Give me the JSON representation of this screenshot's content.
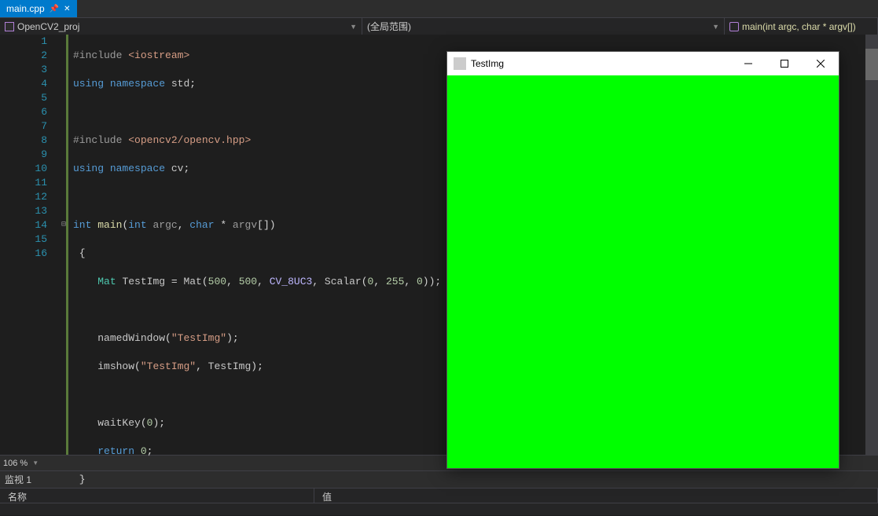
{
  "tab": {
    "label": "main.cpp"
  },
  "nav": {
    "project": "OpenCV2_proj",
    "scope": "(全局范围)",
    "function": "main(int argc, char * argv[])"
  },
  "lines": [
    "1",
    "2",
    "3",
    "4",
    "5",
    "6",
    "7",
    "8",
    "9",
    "10",
    "11",
    "12",
    "13",
    "14",
    "15",
    "16"
  ],
  "code": {
    "l1_include": "#include",
    "l1_hdr": "<iostream>",
    "l2_using": "using",
    "l2_ns": "namespace",
    "l2_std": "std",
    "l4_include": "#include",
    "l4_hdr": "<opencv2/opencv.hpp>",
    "l5_using": "using",
    "l5_ns": "namespace",
    "l5_cv": "cv",
    "l7_int": "int",
    "l7_main": "main",
    "l7_argint": "int",
    "l7_argc": "argc",
    "l7_char": "char",
    "l7_argv": "argv",
    "l9_Mat": "Mat",
    "l9_TestImg": "TestImg",
    "l9_Mat2": "Mat",
    "l9_500a": "500",
    "l9_500b": "500",
    "l9_cv8": "CV_8UC3",
    "l9_Scalar": "Scalar",
    "l9_n0": "0",
    "l9_n255": "255",
    "l9_n0b": "0",
    "l11_nw": "namedWindow",
    "l11_s": "\"TestImg\"",
    "l12_imshow": "imshow",
    "l12_s": "\"TestImg\"",
    "l12_v": "TestImg",
    "l14_waitKey": "waitKey",
    "l14_0": "0",
    "l15_return": "return",
    "l15_0": "0"
  },
  "zoom": "106 %",
  "watch": {
    "title": "监视 1",
    "col_name": "名称",
    "col_value": "值"
  },
  "window": {
    "title": "TestImg"
  },
  "colors": {
    "green": "#00ff00"
  }
}
